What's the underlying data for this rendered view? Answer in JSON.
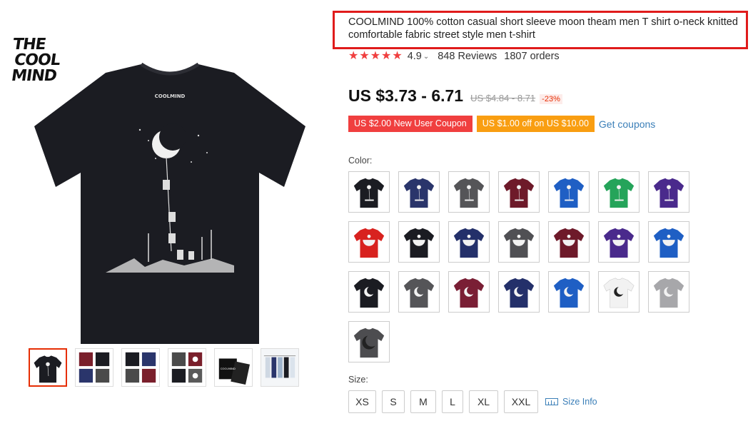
{
  "brand": {
    "logo_lines": [
      "THE",
      "COOL",
      "MIND"
    ],
    "shirt_print_text": "COOLMIND"
  },
  "gallery": {
    "thumbnails": [
      {
        "name": "thumb-black-moon",
        "colors": [
          "#1b1c22"
        ]
      },
      {
        "name": "thumb-color-grid-1",
        "colors": [
          "#7a1f2b",
          "#1b1c22",
          "#2a356b",
          "#4a4a4a"
        ]
      },
      {
        "name": "thumb-color-grid-2",
        "colors": [
          "#1b1c22",
          "#2a356b",
          "#4a4a4a",
          "#7a1f2b"
        ]
      },
      {
        "name": "thumb-color-grid-3",
        "colors": [
          "#4a4a4a",
          "#7a1f2b",
          "#1b1c22",
          "#5a5a5a"
        ]
      },
      {
        "name": "thumb-packaging",
        "colors": [
          "#111111"
        ]
      },
      {
        "name": "thumb-hanging-shirts",
        "colors": [
          "#cfd8e3"
        ]
      }
    ]
  },
  "product": {
    "title": "COOLMIND 100% cotton casual short sleeve moon theam men T shirt o-neck knitted comfortable fabric street style men t-shirt",
    "stars": 5,
    "rating": "4.9",
    "reviews": "848 Reviews",
    "orders": "1807 orders",
    "price": "US $3.73 - 6.71",
    "old_price": "US $4.84 - 8.71",
    "discount": "-23%",
    "coupons": [
      {
        "label": "US $2.00 New User Coupon",
        "color": "#f03f3f"
      },
      {
        "label": "US $1.00 off on US $10.00",
        "color": "#f99e11"
      }
    ],
    "get_coupons_label": "Get coupons",
    "color_label": "Color:",
    "size_label": "Size:",
    "sizes": [
      "XS",
      "S",
      "M",
      "L",
      "XL",
      "XXL"
    ],
    "size_info_label": "Size Info",
    "accent_red": "#e01b1b",
    "link_color": "#3b7fb8"
  },
  "color_swatches": [
    {
      "shirt": "#1b1c22",
      "print": "climber"
    },
    {
      "shirt": "#2a356b",
      "print": "climber"
    },
    {
      "shirt": "#555558",
      "print": "climber"
    },
    {
      "shirt": "#6e1a2a",
      "print": "climber"
    },
    {
      "shirt": "#1f5fc4",
      "print": "climber"
    },
    {
      "shirt": "#25a45a",
      "print": "climber"
    },
    {
      "shirt": "#4a2a8c",
      "print": "climber"
    },
    {
      "shirt": "#d8221f",
      "print": "bowl"
    },
    {
      "shirt": "#1b1c22",
      "print": "bowl"
    },
    {
      "shirt": "#24306a",
      "print": "bowl"
    },
    {
      "shirt": "#505054",
      "print": "bowl"
    },
    {
      "shirt": "#6e1a2a",
      "print": "bowl"
    },
    {
      "shirt": "#4a2a8c",
      "print": "bowl"
    },
    {
      "shirt": "#1f5fc4",
      "print": "bowl"
    },
    {
      "shirt": "#1b1c22",
      "print": "moon"
    },
    {
      "shirt": "#555558",
      "print": "moon"
    },
    {
      "shirt": "#7a1f35",
      "print": "moon"
    },
    {
      "shirt": "#24306a",
      "print": "moon"
    },
    {
      "shirt": "#1f5fc4",
      "print": "moon"
    },
    {
      "shirt": "#f2f2f2",
      "print": "moon"
    },
    {
      "shirt": "#a7a7aa",
      "print": "moon"
    },
    {
      "shirt": "#4d4d50",
      "print": "moon-large"
    }
  ]
}
